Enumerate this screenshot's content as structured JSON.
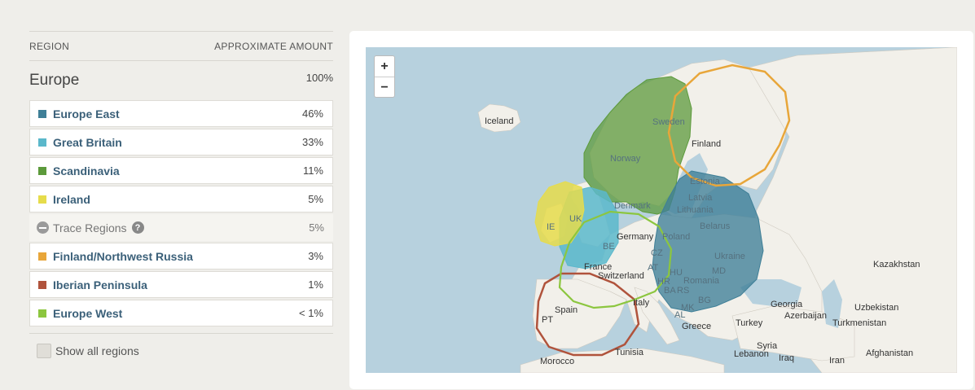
{
  "table": {
    "header_region": "REGION",
    "header_amount": "APPROXIMATE AMOUNT",
    "parent": {
      "name": "Europe",
      "pct": "100%"
    },
    "regions": [
      {
        "name": "Europe East",
        "pct": "46%",
        "color": "#3f7f97"
      },
      {
        "name": "Great Britain",
        "pct": "33%",
        "color": "#5bb8cb"
      },
      {
        "name": "Scandinavia",
        "pct": "11%",
        "color": "#5c9a3b"
      },
      {
        "name": "Ireland",
        "pct": "5%",
        "color": "#e6dc4b"
      }
    ],
    "trace": {
      "label": "Trace Regions",
      "help": "?",
      "pct": "5%"
    },
    "trace_regions": [
      {
        "name": "Finland/Northwest Russia",
        "pct": "3%",
        "color": "#e8a63a"
      },
      {
        "name": "Iberian Peninsula",
        "pct": "1%",
        "color": "#b0533c"
      },
      {
        "name": "Europe West",
        "pct": "< 1%",
        "color": "#8cc63f"
      }
    ],
    "show_all": "Show all regions"
  },
  "map": {
    "zoom_in": "+",
    "zoom_out": "−",
    "labels": {
      "iceland": "Iceland",
      "sweden": "Sweden",
      "norway": "Norway",
      "finland": "Finland",
      "estonia": "Estonia",
      "latvia": "Latvia",
      "lithuania": "Lithuania",
      "belarus": "Belarus",
      "denmark": "Denmark",
      "ie": "IE",
      "uk": "UK",
      "be": "BE",
      "germany": "Germany",
      "poland": "Poland",
      "ukraine": "Ukraine",
      "cz": "CZ",
      "at": "AT",
      "hu": "HU",
      "hr": "HR",
      "md": "MD",
      "romania": "Romania",
      "ba": "BA",
      "rs": "RS",
      "bg": "BG",
      "mk": "MK",
      "al": "AL",
      "france": "France",
      "switzerland": "Switzerland",
      "italy": "Italy",
      "spain": "Spain",
      "pt": "PT",
      "greece": "Greece",
      "turkey": "Turkey",
      "morocco": "Morocco",
      "tunisia": "Tunisia",
      "syria": "Syria",
      "lebanon": "Lebanon",
      "iraq": "Iraq",
      "iran": "Iran",
      "georgia": "Georgia",
      "azerbaijan": "Azerbaijan",
      "turkmenistan": "Turkmenistan",
      "uzbekistan": "Uzbekistan",
      "kazakhstan": "Kazakhstan",
      "afghanistan": "Afghanistan"
    }
  }
}
